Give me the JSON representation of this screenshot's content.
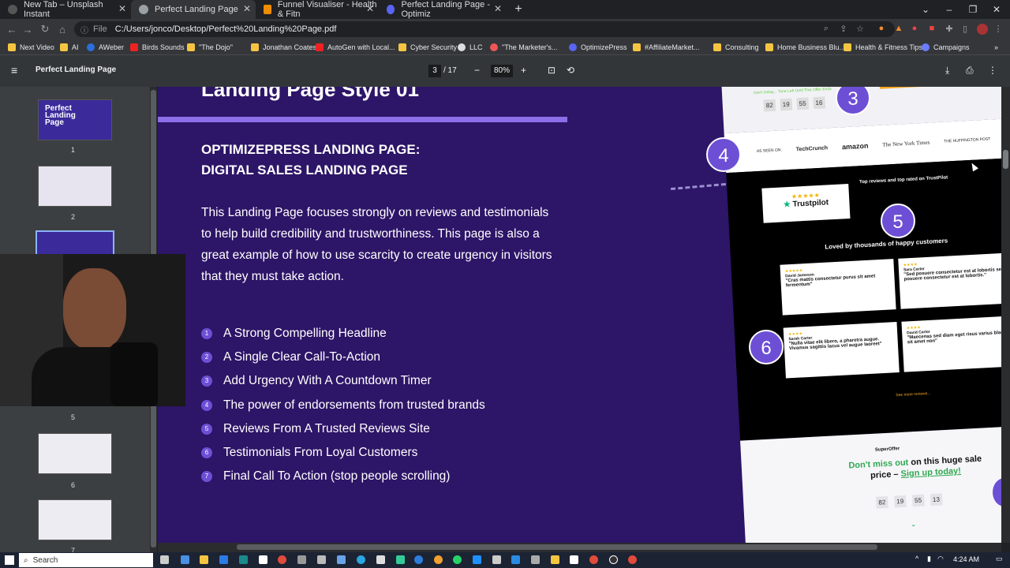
{
  "tabs": [
    {
      "label": "New Tab – Unsplash Instant",
      "active": false
    },
    {
      "label": "Perfect Landing Page",
      "active": true
    },
    {
      "label": "Funnel Visualiser - Health & Fitn",
      "active": false
    },
    {
      "label": "Perfect Landing Page - Optimiz",
      "active": false
    }
  ],
  "address": {
    "scheme": "File",
    "url": "C:/Users/jonco/Desktop/Perfect%20Landing%20Page.pdf"
  },
  "bookmarks": [
    "Next Video",
    "AI",
    "AWeber",
    "Birds Sounds",
    "\"The Dojo\"",
    "Jonathan Coates",
    "AutoGen with Local...",
    "Cyber Security",
    "LLC",
    "\"The Marketer's...",
    "OptimizePress",
    "#AffiliateMarket...",
    "Consulting",
    "Home Business Blu...",
    "Health & Fitness Tips",
    "Campaigns"
  ],
  "pdf": {
    "title": "Perfect Landing Page",
    "page": "3",
    "total": "/ 17",
    "zoom": "80%"
  },
  "thumbs": [
    "1",
    "2",
    "5",
    "6",
    "7"
  ],
  "thumb1": {
    "l1": "Perfect",
    "l2": "Landing",
    "l3": "Page"
  },
  "slide": {
    "title": "Landing Page Style 01",
    "subtitle1": "OPTIMIZEPRESS LANDING PAGE:",
    "subtitle2": "DIGITAL SALES LANDING PAGE",
    "intro": "This Landing Page focuses strongly on reviews and testimonials to help build credibility and trustworthiness. This page is also a great example of how to use scarcity to create urgency in visitors that they must take action.",
    "points": [
      {
        "n": "1",
        "t": "A Strong Compelling Headline"
      },
      {
        "n": "2",
        "t": "A Single Clear Call-To-Action"
      },
      {
        "n": "3",
        "t": "Add Urgency With A Countdown Timer"
      },
      {
        "n": "4",
        "t": "The power of endorsements from trusted brands"
      },
      {
        "n": "5",
        "t": "Reviews From A Trusted Reviews Site"
      },
      {
        "n": "6",
        "t": "Testimonials From Loyal Customers"
      },
      {
        "n": "7",
        "t": "Final Call To Action (stop people scrolling)"
      }
    ],
    "callouts": [
      "3",
      "4",
      "5",
      "6"
    ]
  },
  "preview": {
    "urgency": "Don't Delay... Time Left Until This Offer Ends",
    "timer": [
      "82",
      "19",
      "55",
      "16"
    ],
    "asseen": "AS SEEN ON:",
    "brands": [
      "TechCrunch",
      "amazon",
      "The New York Times",
      "THE HUFFINGTON POST"
    ],
    "trustpilot": "Trustpilot",
    "reviews_head": "Top reviews and top rated on TrustPilot",
    "loved": "Loved by thousands of happy customers",
    "cards": [
      {
        "name": "David Jameson",
        "quote": "\"Cras mattis consectetur purus sit amet fermentum\""
      },
      {
        "name": "Sara Carter",
        "quote": "\"Sed posuere consectetur est at lobortis sed posuere consectetur est at lobortis.\""
      },
      {
        "name": "Sarah Carter",
        "quote": "\"Nulla vitae elit libero, a pharetra augue. Vivamus sagittis lacus vel augue laoreet\""
      },
      {
        "name": "David Carter",
        "quote": "\"Maecenas sed diam eget risus varius blandit sit amet non\""
      }
    ],
    "seemore": "See more reviews...",
    "brand": "SuperOffer",
    "cta1": "Don't miss out",
    "cta2": "on this huge",
    "cta3": "sale price –",
    "cta4": "Sign up today!",
    "timer2": [
      "82",
      "19",
      "55",
      "13"
    ]
  },
  "taskbar": {
    "search": "Search",
    "time": "4:24 AM"
  },
  "colors": {
    "slide_bg": "#2d1567",
    "accent": "#6d4fd6",
    "bar": "#8b6ee8"
  }
}
